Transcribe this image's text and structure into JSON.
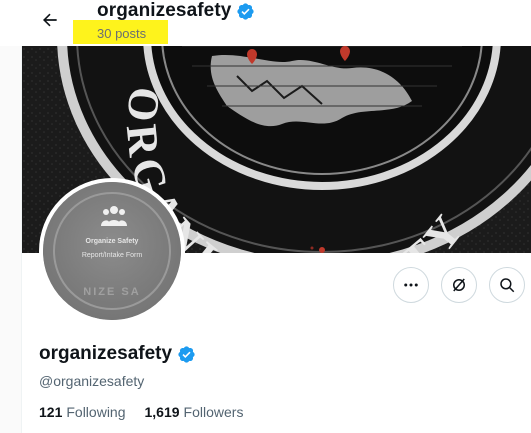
{
  "header": {
    "name": "organizesafety",
    "post_count": "30 posts"
  },
  "banner": {
    "text": "ORGANIZE SAFETY"
  },
  "avatar": {
    "line1": "Organize Safety",
    "line2": "Report/Intake Form",
    "arc_text": "NIZE SA"
  },
  "profile": {
    "name": "organizesafety",
    "handle": "@organizesafety",
    "following_count": "121",
    "following_label": "Following",
    "followers_count": "1,619",
    "followers_label": "Followers"
  },
  "icons": {
    "back": "arrow-left-icon",
    "verified": "verified-badge-icon",
    "more": "more-icon",
    "grok": "grok-icon",
    "search": "search-icon"
  },
  "colors": {
    "verified_blue": "#1d9bf0",
    "highlight": "#fef31c",
    "secondary_text": "#536471",
    "border": "#cfd9de"
  }
}
